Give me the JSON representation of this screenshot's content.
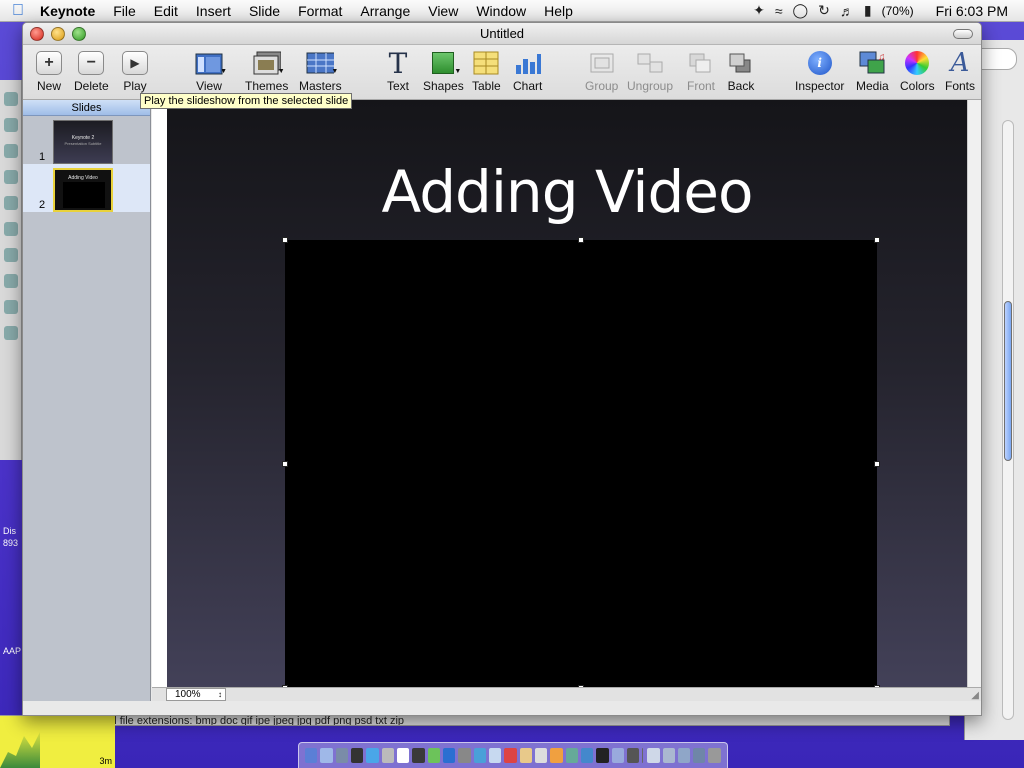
{
  "menubar": {
    "app_name": "Keynote",
    "items": [
      "File",
      "Edit",
      "Insert",
      "Slide",
      "Format",
      "Arrange",
      "View",
      "Window",
      "Help"
    ],
    "battery": "(70%)",
    "clock": "Fri 6:03 PM"
  },
  "window": {
    "title": "Untitled"
  },
  "toolbar": {
    "new": "New",
    "delete": "Delete",
    "play": "Play",
    "view": "View",
    "themes": "Themes",
    "masters": "Masters",
    "text": "Text",
    "shapes": "Shapes",
    "table": "Table",
    "chart": "Chart",
    "group": "Group",
    "ungroup": "Ungroup",
    "front": "Front",
    "back": "Back",
    "inspector": "Inspector",
    "media": "Media",
    "colors": "Colors",
    "fonts": "Fonts"
  },
  "tooltip": "Play the slideshow from the selected slide",
  "slides_panel": {
    "header": "Slides",
    "slides": [
      {
        "number": "1",
        "thumb_title": "Keynote 2",
        "thumb_subtitle": "Presentation Subtitle"
      },
      {
        "number": "2",
        "thumb_title": "Adding Video"
      }
    ]
  },
  "slide": {
    "title": "Adding Video"
  },
  "status": {
    "zoom": "100%"
  },
  "background": {
    "bottom_sheet_text": "Valid file extensions: bmp doc gif ipe jpeg jpg pdf png psd txt zip",
    "widget_label": "3m",
    "left_labels": [
      "Dis",
      "893",
      "AAP"
    ]
  },
  "colors": {
    "desktop": "#4a32c8",
    "selection_border": "#e9d23b",
    "tooltip_bg": "#ffffc9"
  }
}
